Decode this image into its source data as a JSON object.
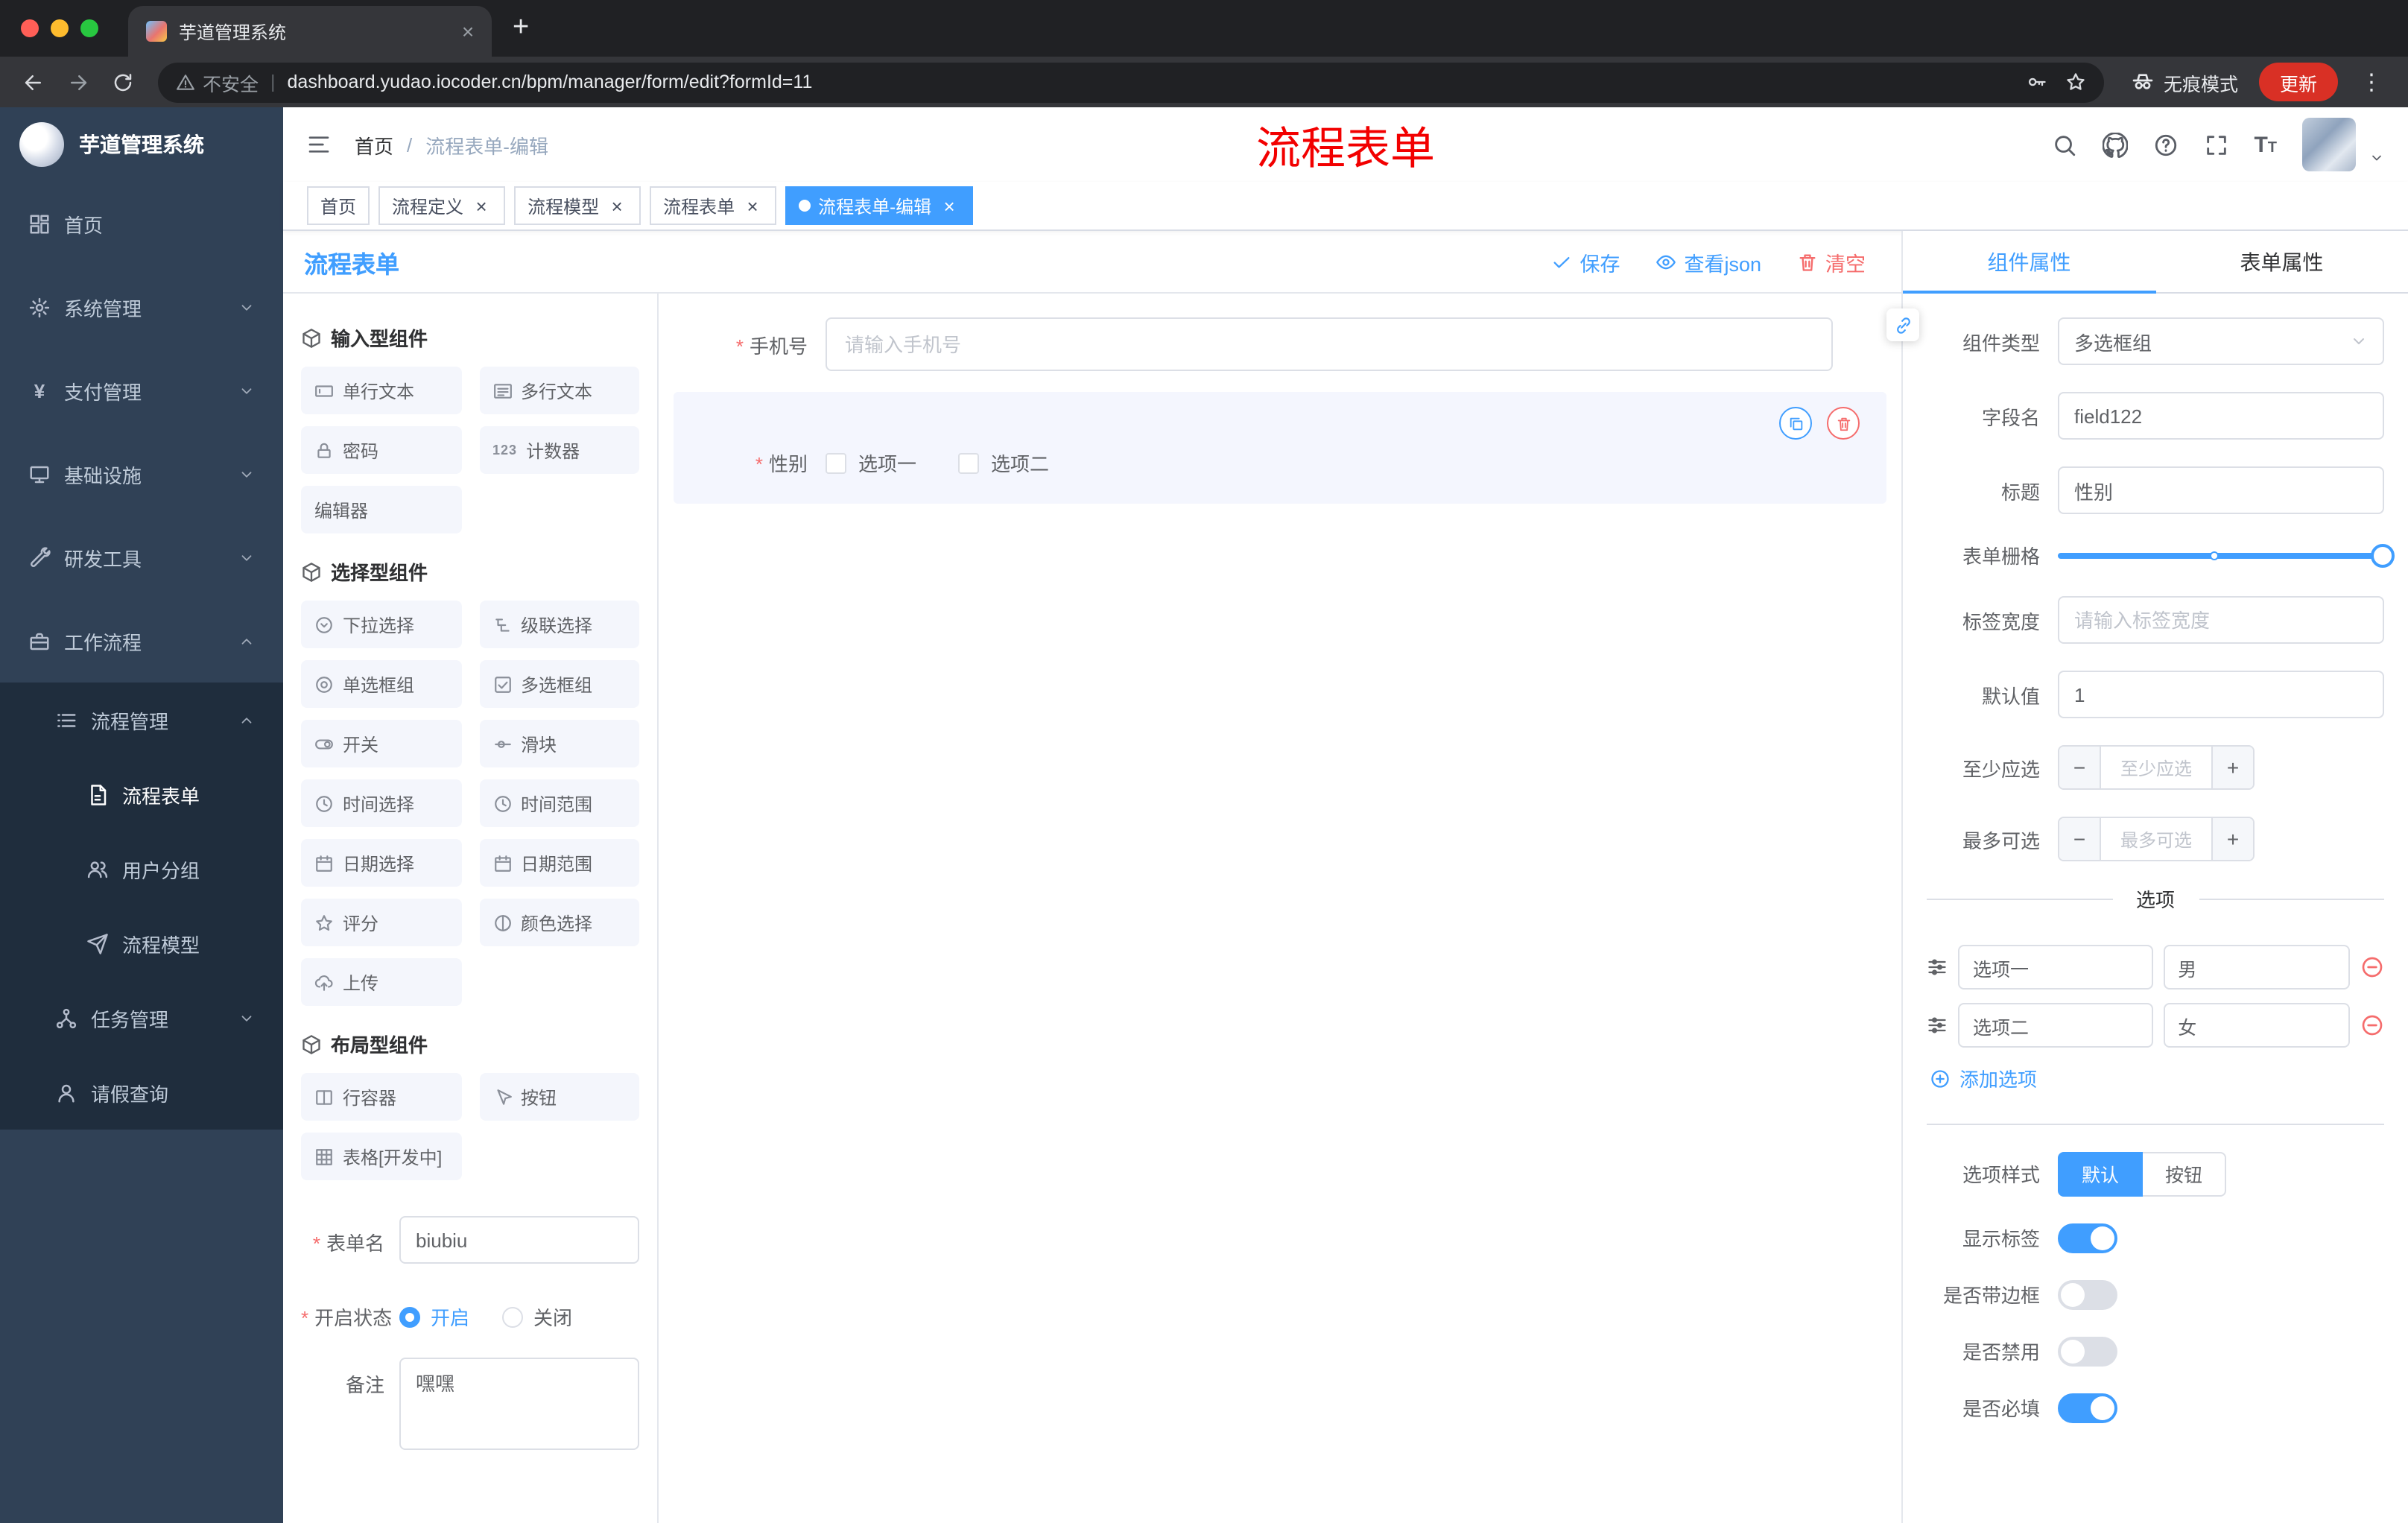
{
  "colors": {
    "primary": "#409EFF",
    "danger": "#F56C6C",
    "sidebar": "#304156",
    "sidebar_sub": "#1f2d3d",
    "annotation_red": "#f20000",
    "update_red": "#d93025"
  },
  "icons": {
    "kebab": "⋮",
    "close": "×",
    "plus": "+",
    "minus": "−",
    "yen": "¥",
    "counter": "123",
    "font_size": "T",
    "slash": "/",
    "pipe": "|"
  },
  "browser": {
    "tab_title": "芋道管理系统",
    "security": "不安全",
    "url": "dashboard.yudao.iocoder.cn/bpm/manager/form/edit?formId=11",
    "incognito": "无痕模式",
    "update": "更新"
  },
  "sidebar": {
    "title": "芋道管理系统",
    "items": [
      {
        "label": "首页"
      },
      {
        "label": "系统管理"
      },
      {
        "label": "支付管理"
      },
      {
        "label": "基础设施"
      },
      {
        "label": "研发工具"
      },
      {
        "label": "工作流程"
      },
      {
        "label": "流程管理"
      },
      {
        "label": "流程表单"
      },
      {
        "label": "用户分组"
      },
      {
        "label": "流程模型"
      },
      {
        "label": "任务管理"
      },
      {
        "label": "请假查询"
      }
    ]
  },
  "header": {
    "breadcrumb_home": "首页",
    "breadcrumb_current": "流程表单-编辑",
    "annotation": "流程表单"
  },
  "tags": [
    {
      "label": "首页"
    },
    {
      "label": "流程定义"
    },
    {
      "label": "流程模型"
    },
    {
      "label": "流程表单"
    },
    {
      "label": "流程表单-编辑"
    }
  ],
  "designer": {
    "title": "流程表单",
    "save": "保存",
    "view_json": "查看json",
    "clear": "清空",
    "palette": {
      "input_title": "输入型组件",
      "input_items": [
        "单行文本",
        "多行文本",
        "密码",
        "计数器",
        "编辑器"
      ],
      "select_title": "选择型组件",
      "select_items": [
        "下拉选择",
        "级联选择",
        "单选框组",
        "多选框组",
        "开关",
        "滑块",
        "时间选择",
        "时间范围",
        "日期选择",
        "日期范围",
        "评分",
        "颜色选择",
        "上传"
      ],
      "layout_title": "布局型组件",
      "layout_items": [
        "行容器",
        "按钮",
        "表格[开发中]"
      ]
    },
    "meta": {
      "name_label": "表单名",
      "name_value": "biubiu",
      "status_label": "开启状态",
      "status_on": "开启",
      "status_off": "关闭",
      "remark_label": "备注",
      "remark_value": "嘿嘿"
    },
    "canvas": {
      "phone_label": "手机号",
      "phone_placeholder": "请输入手机号",
      "gender_label": "性别",
      "gender_opt1": "选项一",
      "gender_opt2": "选项二"
    }
  },
  "props": {
    "tab_component": "组件属性",
    "tab_form": "表单属性",
    "type_label": "组件类型",
    "type_value": "多选框组",
    "field_label": "字段名",
    "field_value": "field122",
    "title_label": "标题",
    "title_value": "性别",
    "grid_label": "表单栅格",
    "width_label": "标签宽度",
    "width_placeholder": "请输入标签宽度",
    "default_label": "默认值",
    "default_value": "1",
    "min_label": "至少应选",
    "min_placeholder": "至少应选",
    "max_label": "最多可选",
    "max_placeholder": "最多可选",
    "options_title": "选项",
    "options": [
      {
        "name": "选项一",
        "value": "男"
      },
      {
        "name": "选项二",
        "value": "女"
      }
    ],
    "add_option": "添加选项",
    "style_label": "选项样式",
    "style_default": "默认",
    "style_button": "按钮",
    "show_label": "显示标签",
    "border_label": "是否带边框",
    "disabled_label": "是否禁用",
    "required_label": "是否必填"
  }
}
